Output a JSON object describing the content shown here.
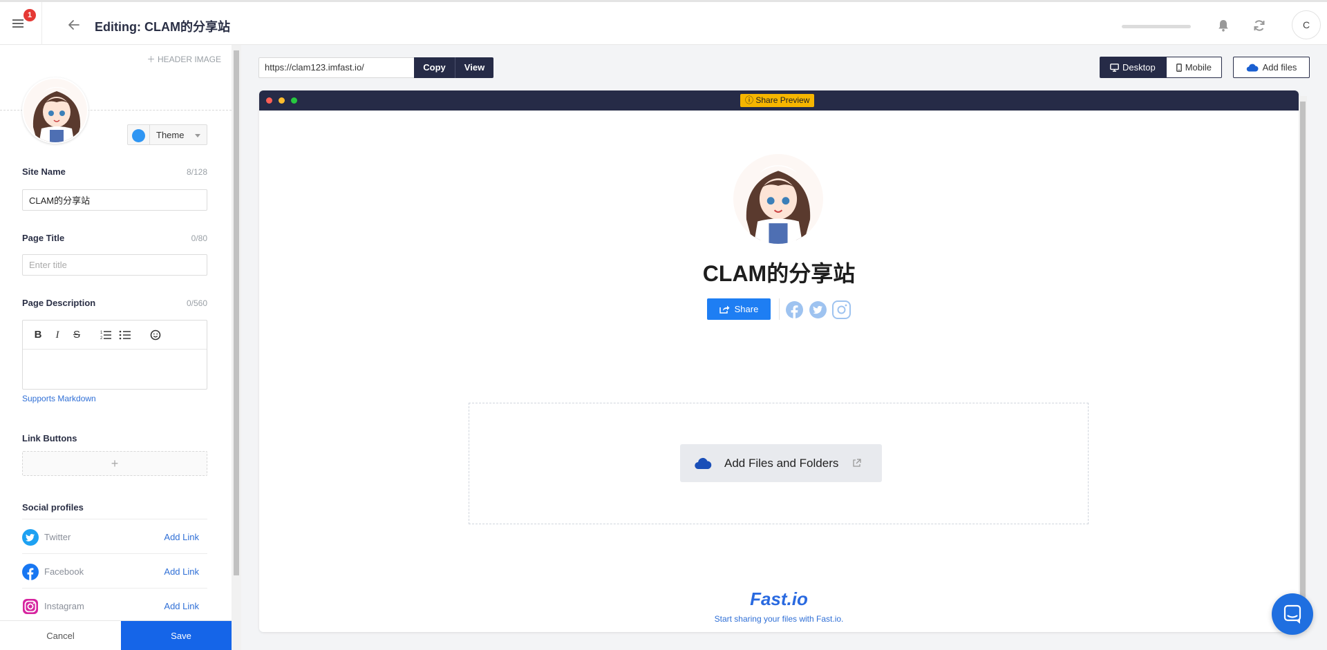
{
  "topbar": {
    "notification_count": "1",
    "title": "Editing: CLAM的分享站",
    "user_initial": "C"
  },
  "panel": {
    "header_image_label": "HEADER IMAGE",
    "theme_label": "Theme",
    "theme_color": "#2f96f3",
    "site_name": {
      "label": "Site Name",
      "count": "8/128",
      "value": "CLAM的分享站"
    },
    "page_title": {
      "label": "Page Title",
      "count": "0/80",
      "placeholder": "Enter title"
    },
    "page_description": {
      "label": "Page Description",
      "count": "0/560"
    },
    "markdown_link": "Supports Markdown",
    "link_buttons_label": "Link Buttons",
    "add_link_symbol": "+",
    "social_label": "Social profiles",
    "socials": [
      {
        "name": "Twitter",
        "action": "Add Link"
      },
      {
        "name": "Facebook",
        "action": "Add Link"
      },
      {
        "name": "Instagram",
        "action": "Add Link"
      }
    ],
    "cancel": "Cancel",
    "save": "Save"
  },
  "urlbar": {
    "url": "https://clam123.imfast.io/",
    "copy": "Copy",
    "view": "View",
    "desktop": "Desktop",
    "mobile": "Mobile",
    "add_files": "Add files"
  },
  "preview": {
    "badge": "Share Preview",
    "site_title": "CLAM的分享站",
    "share": "Share",
    "add_files_folders": "Add Files and Folders",
    "footer_logo": "Fast.io",
    "footer_text": "Start sharing your files with Fast.io."
  },
  "colors": {
    "navy": "#262b47",
    "primary_blue": "#1565e8",
    "badge_yellow": "#f6b600"
  }
}
